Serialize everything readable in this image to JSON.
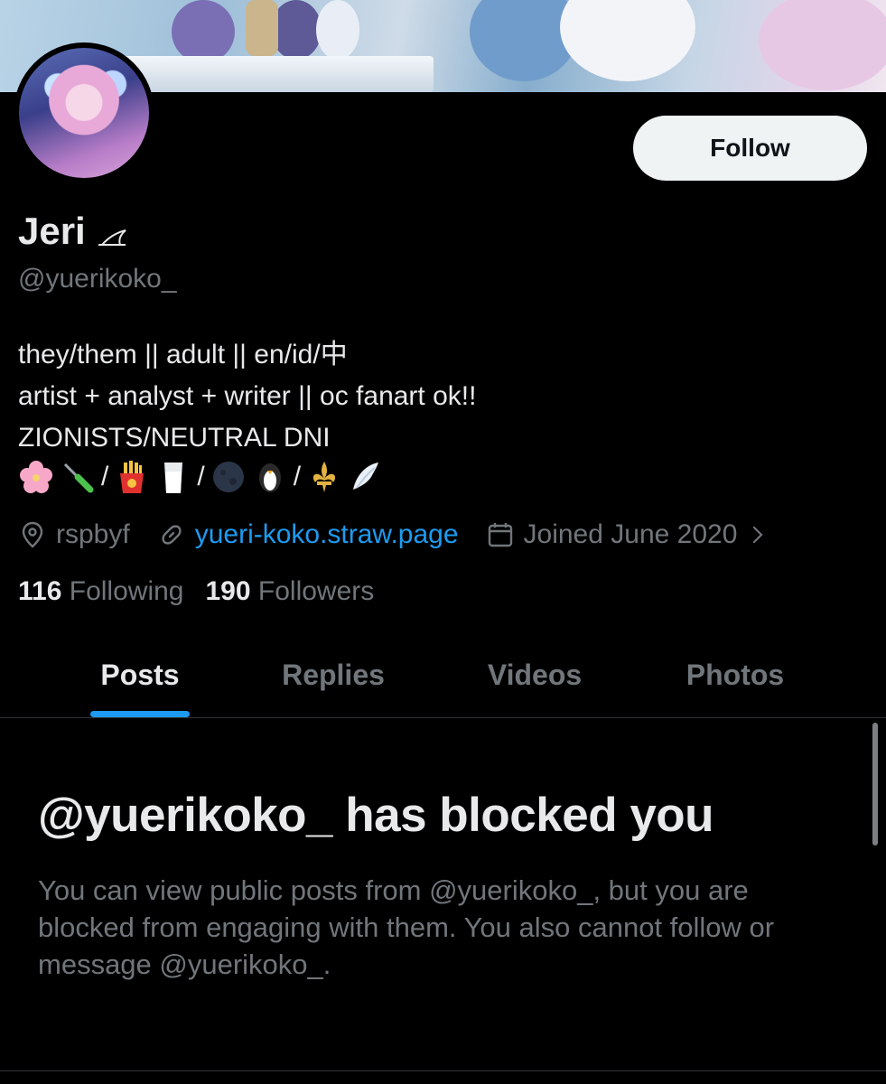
{
  "profile": {
    "name": "Jeri",
    "handle": "@yuerikoko_",
    "follow_label": "Follow",
    "bio_lines": [
      "they/them || adult || en/id/中",
      "artist + analyst + writer || oc fanart ok!!",
      "ZIONISTS/NEUTRAL DNI"
    ],
    "emoji_row": [
      "cherry-blossom",
      "screwdriver",
      "/",
      "fries",
      "milk",
      "/",
      "new-moon",
      "penguin",
      "/",
      "fleur-de-lis",
      "wing"
    ],
    "separator": "/",
    "location": "rspbyf",
    "website": "yueri-koko.straw.page",
    "joined": "Joined June 2020"
  },
  "stats": {
    "following_count": "116",
    "following_label": "Following",
    "followers_count": "190",
    "followers_label": "Followers"
  },
  "tabs": [
    {
      "label": "Posts",
      "active": true
    },
    {
      "label": "Replies",
      "active": false
    },
    {
      "label": "Videos",
      "active": false
    },
    {
      "label": "Photos",
      "active": false
    }
  ],
  "blocked": {
    "title": "@yuerikoko_ has blocked you",
    "message": "You can view public posts from @yuerikoko_, but you are blocked from engaging with them. You also cannot follow or message @yuerikoko_."
  },
  "colors": {
    "background": "#000000",
    "text": "#e7e9ea",
    "muted": "#71767b",
    "accent": "#1d9bf0",
    "follow_bg": "#eff3f4"
  }
}
